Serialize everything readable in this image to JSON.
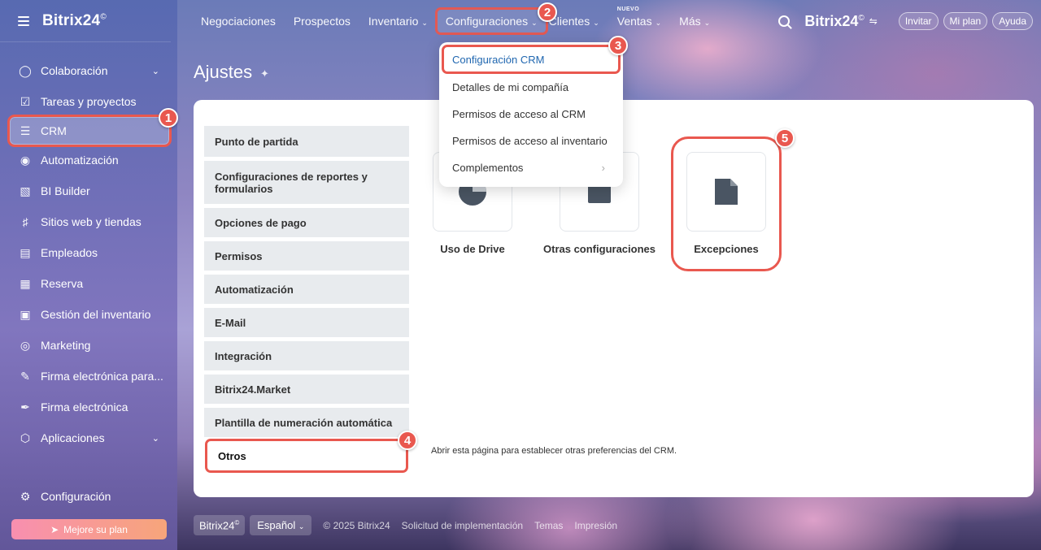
{
  "app": {
    "brand": "Bitrix24",
    "brand_mark": "©"
  },
  "sidebar": {
    "items": [
      {
        "label": "Colaboración",
        "icon": "chat-bubbles-icon",
        "has_chevron": true
      },
      {
        "label": "Tareas y proyectos",
        "icon": "checkbox-icon"
      },
      {
        "label": "CRM",
        "icon": "funnel-icon",
        "active": true
      },
      {
        "label": "Automatización",
        "icon": "robot-icon"
      },
      {
        "label": "BI Builder",
        "icon": "bar-chart-icon"
      },
      {
        "label": "Sitios web y tiendas",
        "icon": "cart-icon"
      },
      {
        "label": "Empleados",
        "icon": "id-card-icon"
      },
      {
        "label": "Reserva",
        "icon": "calendar-icon"
      },
      {
        "label": "Gestión del inventario",
        "icon": "warehouse-icon"
      },
      {
        "label": "Marketing",
        "icon": "target-icon"
      },
      {
        "label": "Firma electrónica para...",
        "icon": "signature-doc-icon"
      },
      {
        "label": "Firma electrónica",
        "icon": "pen-icon"
      },
      {
        "label": "Aplicaciones",
        "icon": "cube-icon",
        "has_chevron": true
      }
    ],
    "config_label": "Configuración",
    "upgrade_label": "Mejore su plan"
  },
  "topnav": {
    "items": [
      {
        "label": "Negociaciones"
      },
      {
        "label": "Prospectos"
      },
      {
        "label": "Inventario",
        "dropdown": true
      },
      {
        "label": "Configuraciones",
        "dropdown": true,
        "highlight": true
      },
      {
        "label": "Clientes",
        "dropdown": true
      },
      {
        "label": "Ventas",
        "dropdown": true,
        "tag": "NUEVO"
      },
      {
        "label": "Más",
        "dropdown": true
      }
    ],
    "right": {
      "brand": "Bitrix24",
      "invite": "Invitar",
      "plan": "Mi plan",
      "help": "Ayuda"
    }
  },
  "page": {
    "title": "Ajustes"
  },
  "dropdown_menu": {
    "items": [
      {
        "label": "Configuración CRM",
        "selected": true
      },
      {
        "label": "Detalles de mi compañía"
      },
      {
        "label": "Permisos de acceso al CRM"
      },
      {
        "label": "Permisos de acceso al inventario"
      },
      {
        "label": "Complementos",
        "submenu": true
      }
    ]
  },
  "settings_tabs": [
    {
      "label": "Punto de partida"
    },
    {
      "label": "Configuraciones de reportes y formularios"
    },
    {
      "label": "Opciones de pago"
    },
    {
      "label": "Permisos"
    },
    {
      "label": "Automatización"
    },
    {
      "label": "E-Mail"
    },
    {
      "label": "Integración"
    },
    {
      "label": "Bitrix24.Market"
    },
    {
      "label": "Plantilla de numeración automática"
    },
    {
      "label": "Otros",
      "active": true
    }
  ],
  "tiles": [
    {
      "label": "Uso de Drive",
      "icon": "pie-chart-icon"
    },
    {
      "label": "Otras configuraciones",
      "icon": "settings-square-icon"
    },
    {
      "label": "Excepciones",
      "icon": "document-icon",
      "highlight": true
    }
  ],
  "description": "Abrir esta página para establecer otras preferencias del CRM.",
  "callouts": [
    "1",
    "2",
    "3",
    "4",
    "5"
  ],
  "footer": {
    "brand": "Bitrix24",
    "language": "Español",
    "copyright": "© 2025 Bitrix24",
    "links": [
      "Solicitud de implementación",
      "Temas",
      "Impresión"
    ]
  },
  "colors": {
    "accent": "#2067b0",
    "callout": "#e9584f"
  }
}
